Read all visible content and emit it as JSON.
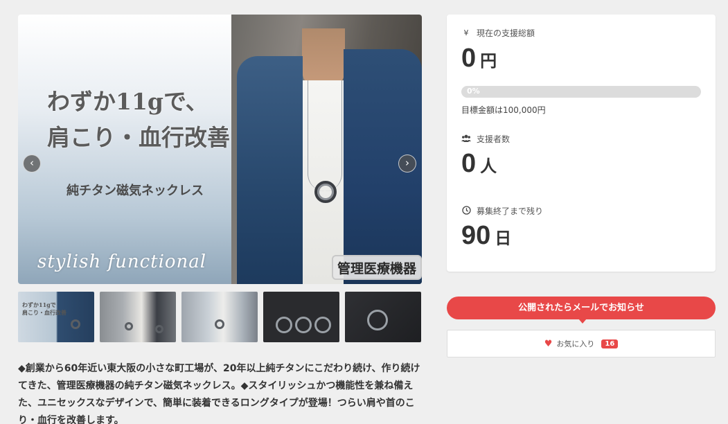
{
  "slider": {
    "headline_line1": "わずか11gで、",
    "headline_line2": "肩こり・血行改善",
    "subline": "純チタン磁気ネックレス",
    "script_text": "stylish functional",
    "badge": "管理医療機器",
    "prev_icon": "‹",
    "next_icon": "›"
  },
  "thumbnails": [
    {
      "name": "thumb-1",
      "mini": "わずか11gで\n肩こり・血行改善"
    },
    {
      "name": "thumb-2"
    },
    {
      "name": "thumb-3"
    },
    {
      "name": "thumb-4"
    },
    {
      "name": "thumb-5"
    }
  ],
  "description": "◆創業から60年近い東大阪の小さな町工場が、20年以上純チタンにこだわり続け、作り続けてきた、管理医療機器の純チタン磁気ネックレス。◆スタイリッシュかつ機能性を兼ね備えた、ユニセックスなデザインで、簡単に装着できるロングタイプが登場！つらい肩や首のこり・血行を改善します。",
  "stats": {
    "total_label": "現在の支援総額",
    "total_icon": "¥",
    "total_value": "0",
    "total_unit": "円",
    "progress_percent": 0,
    "progress_label": "0%",
    "goal_text": "目標金額は100,000円",
    "backers_label": "支援者数",
    "backers_value": "0",
    "backers_unit": "人",
    "remaining_label": "募集終了まで残り",
    "remaining_value": "90",
    "remaining_unit": "日"
  },
  "notify_button_label": "公開されたらメールでお知らせ",
  "favorite": {
    "label": "お気に入り",
    "count": "16"
  },
  "colors": {
    "accent": "#e84848",
    "background": "#efefef"
  }
}
